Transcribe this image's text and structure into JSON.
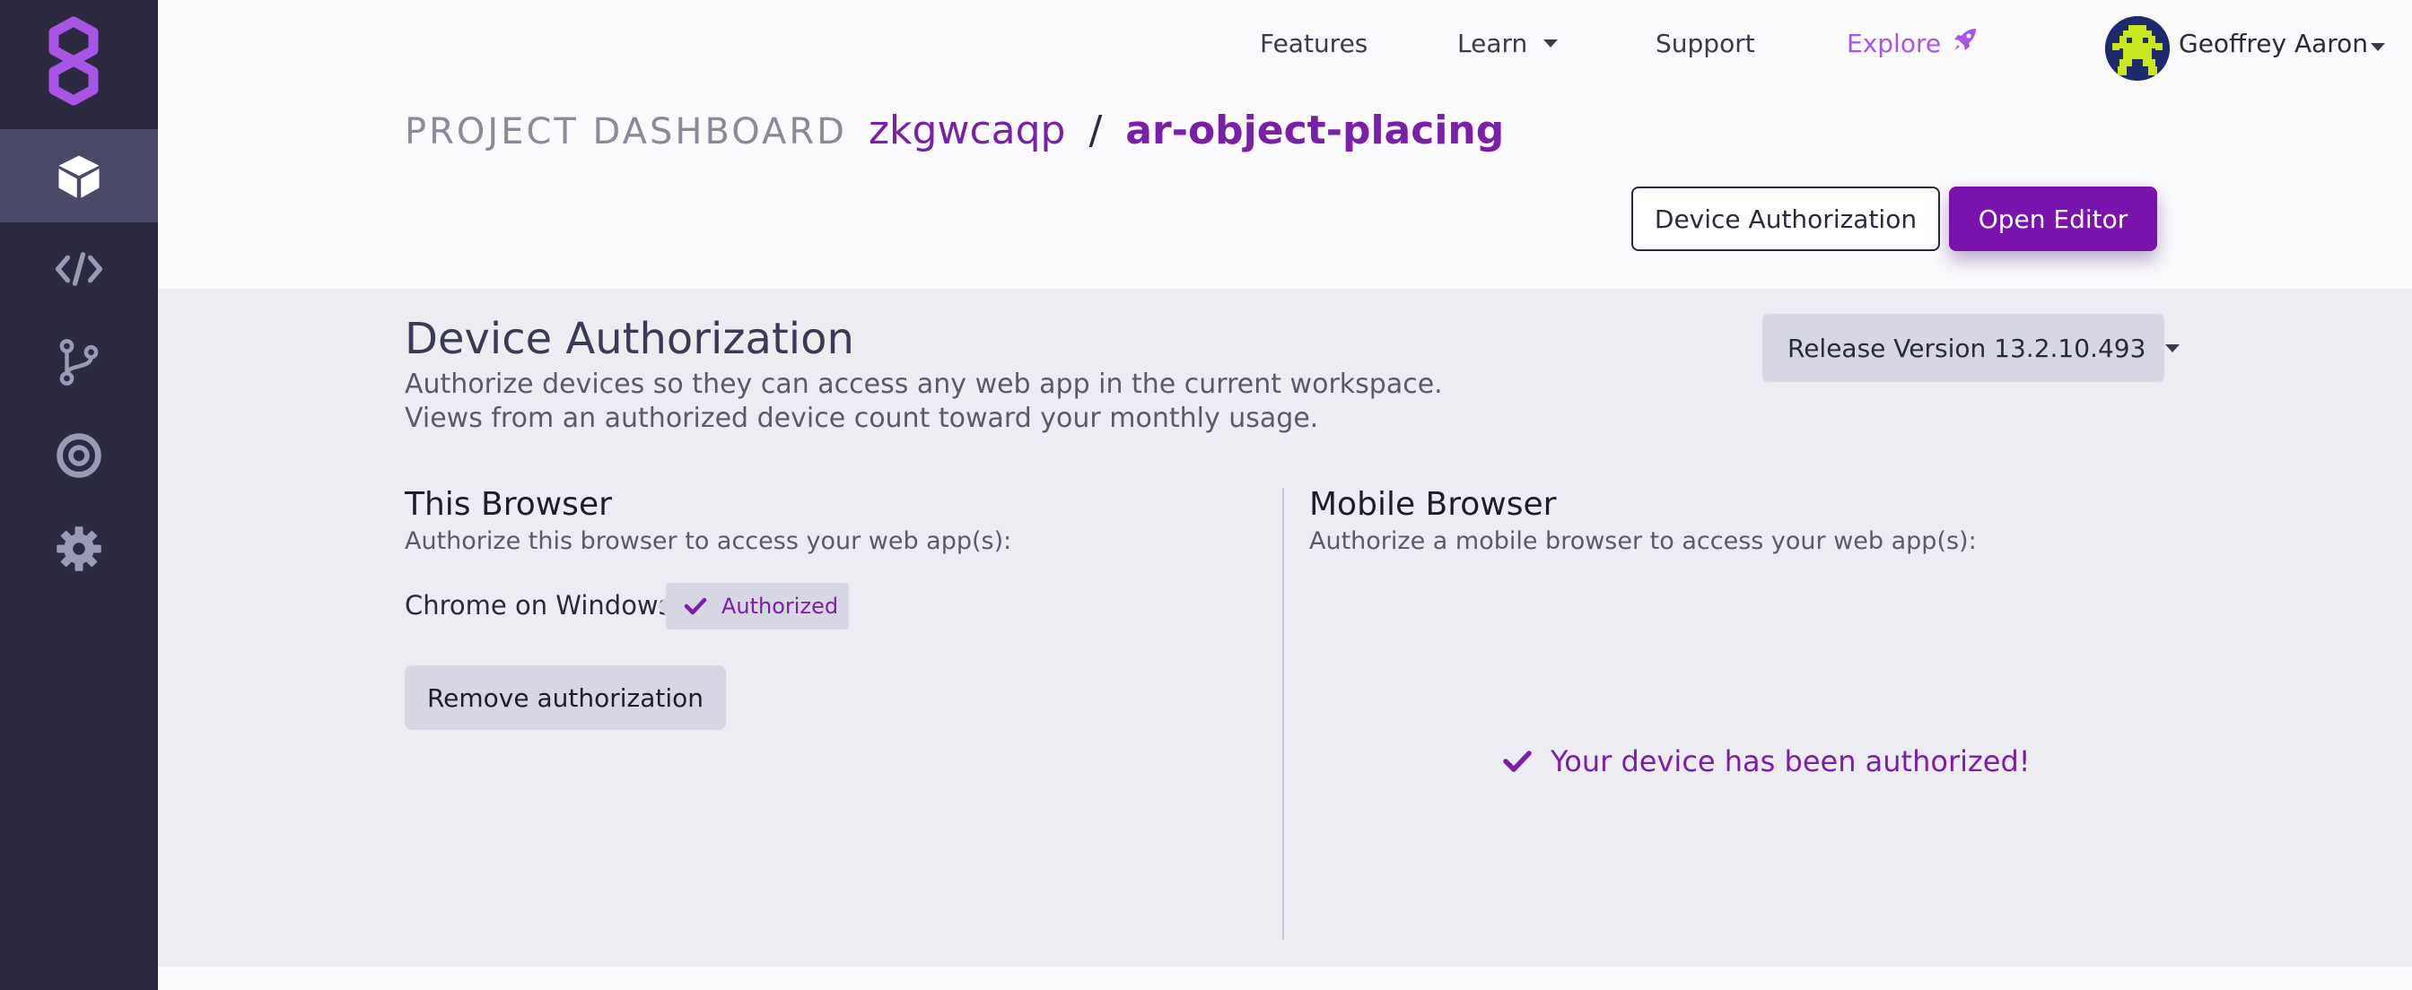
{
  "nav": {
    "features": "Features",
    "learn": "Learn",
    "support": "Support",
    "explore": "Explore",
    "user_name": "Geoffrey Aaron"
  },
  "breadcrumb": {
    "label": "PROJECT DASHBOARD",
    "workspace": "zkgwcaqp",
    "separator": "/",
    "project": "ar-object-placing"
  },
  "header_buttons": {
    "device_authorization": "Device Authorization",
    "open_editor": "Open Editor"
  },
  "section": {
    "title": "Device Authorization",
    "description_line1": "Authorize devices so they can access any web app in the current workspace.",
    "description_line2": "Views from an authorized device count toward your monthly usage.",
    "release_version": "Release Version 13.2.10.493"
  },
  "this_browser": {
    "title": "This Browser",
    "description": "Authorize this browser to access your web app(s):",
    "browser_name": "Chrome on Windows",
    "status_badge": "Authorized",
    "remove_button": "Remove authorization"
  },
  "mobile_browser": {
    "title": "Mobile Browser",
    "description": "Authorize a mobile browser to access your web app(s):",
    "success_message": "Your device has been authorized!"
  },
  "sidebar": {
    "items": [
      "cube-icon",
      "code-icon",
      "branch-icon",
      "target-icon",
      "gear-icon"
    ],
    "active_index": 0
  },
  "colors": {
    "sidebar_bg": "#2b2a40",
    "brand_purple": "#7a12ad",
    "explore_purple": "#a855e6",
    "panel_bg": "#ececf2"
  }
}
